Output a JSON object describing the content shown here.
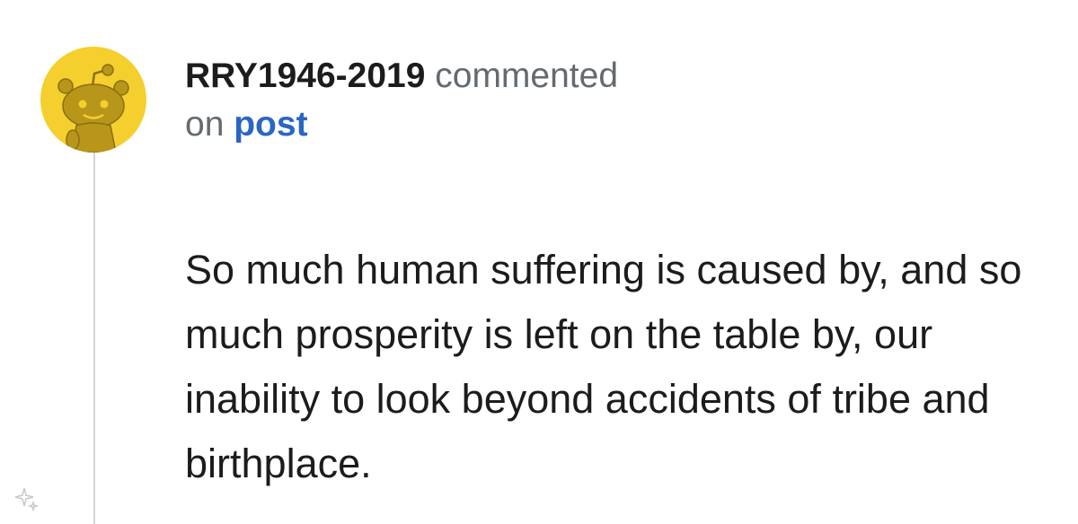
{
  "comment": {
    "username": "RRY1946-2019",
    "action_text": "commented",
    "on_text": "on",
    "post_link_label": "post",
    "body": "So much human suffering is caused by, and so much prosperity is left on the table by, our inability to look beyond accidents of tribe and birthplace."
  },
  "icons": {
    "avatar": "snoo-avatar-icon",
    "sparkle": "sparkle-icon"
  },
  "colors": {
    "avatar_background": "#f4cf2e",
    "link": "#2a66c4",
    "meta_text": "#636a70",
    "thread_line": "#d4d4d4"
  }
}
